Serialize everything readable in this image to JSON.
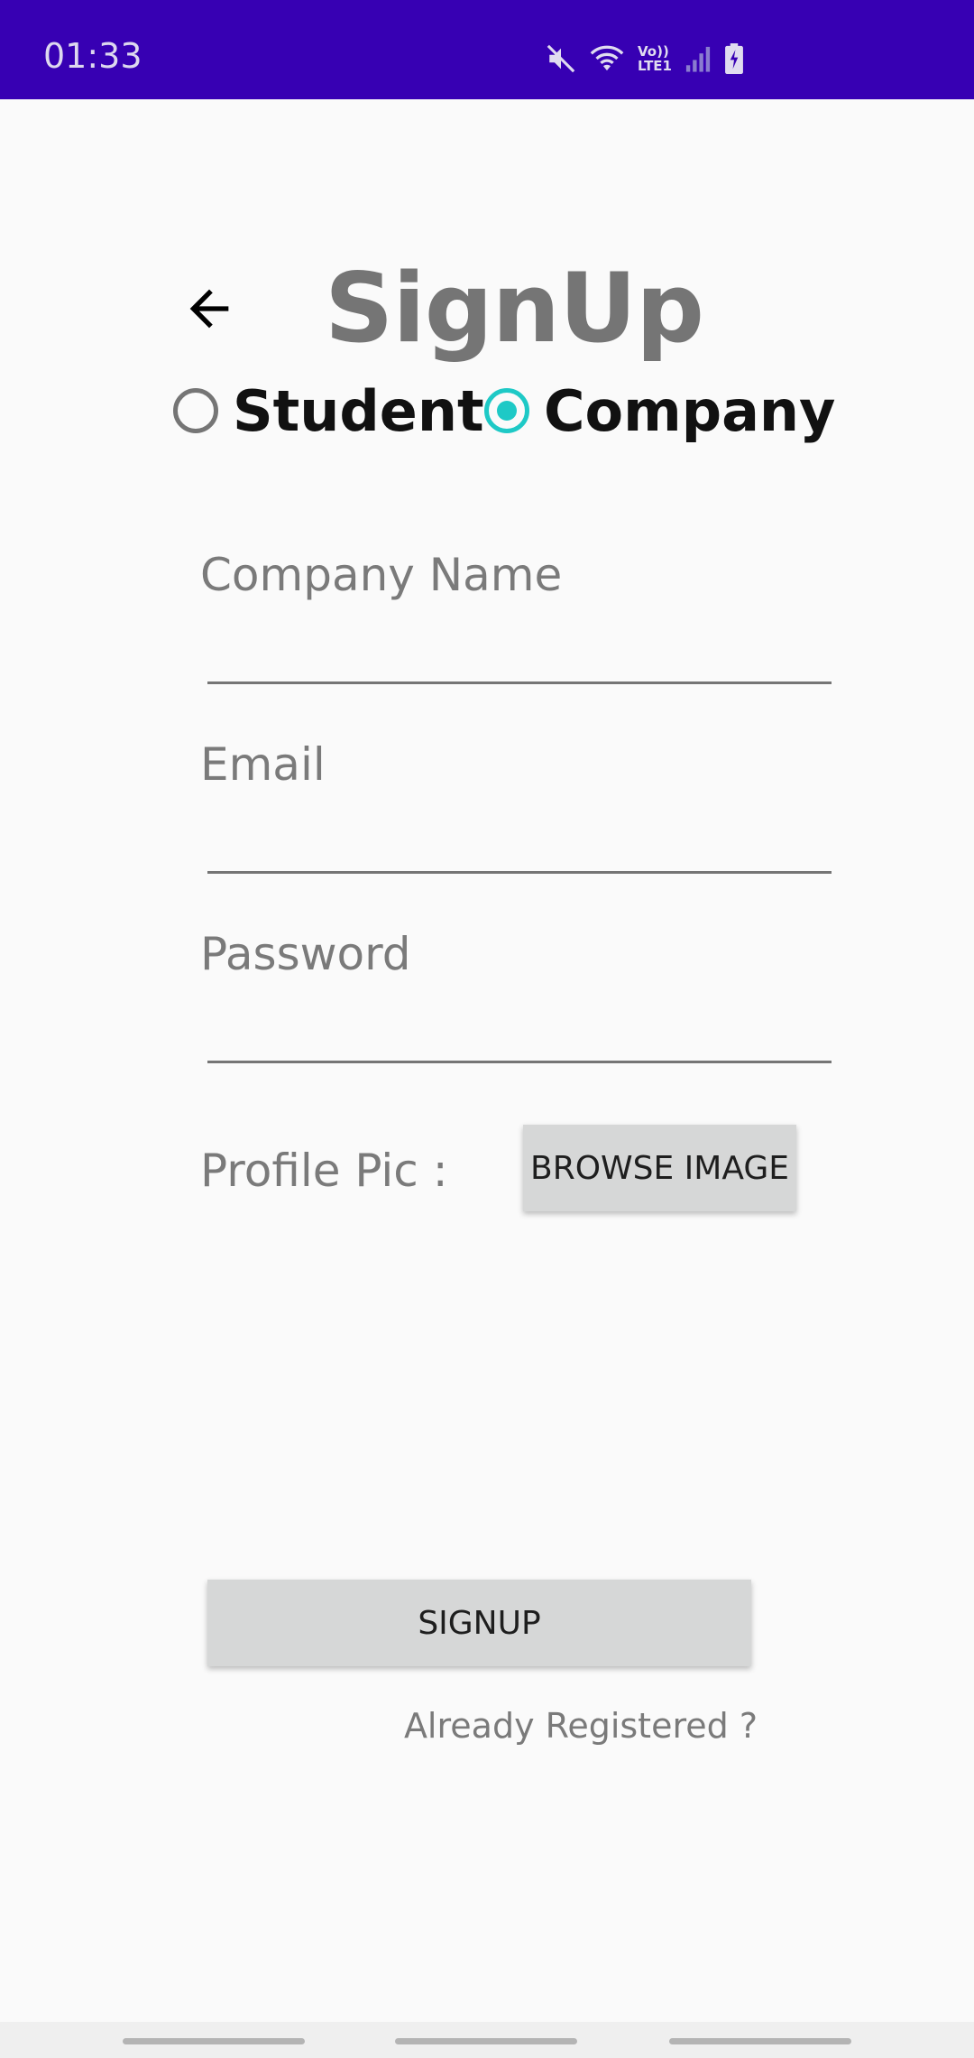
{
  "status_bar": {
    "time": "01:33",
    "icons": [
      "mute-icon",
      "wifi-icon",
      "volte-icon",
      "signal-icon",
      "battery-charging-icon"
    ],
    "volte_text_top": "Vo))",
    "volte_text_bottom": "LTE1"
  },
  "header": {
    "title": "SignUp",
    "back_icon": "arrow-left-icon"
  },
  "user_type": {
    "options": [
      {
        "label": "Student",
        "checked": false
      },
      {
        "label": "Company",
        "checked": true
      }
    ]
  },
  "form": {
    "company_name_hint": "Company Name",
    "email_hint": "Email",
    "password_hint": "Password",
    "profile_pic_label": "Profile Pic :",
    "browse_button": "BROWSE IMAGE",
    "signup_button": "SIGNUP",
    "login_link": "Already Registered ?"
  },
  "colors": {
    "status_bar": "#3700b3",
    "accent": "#1ec9c6",
    "button_bg": "#d6d7d7",
    "hint_text": "#7a7a7a"
  }
}
